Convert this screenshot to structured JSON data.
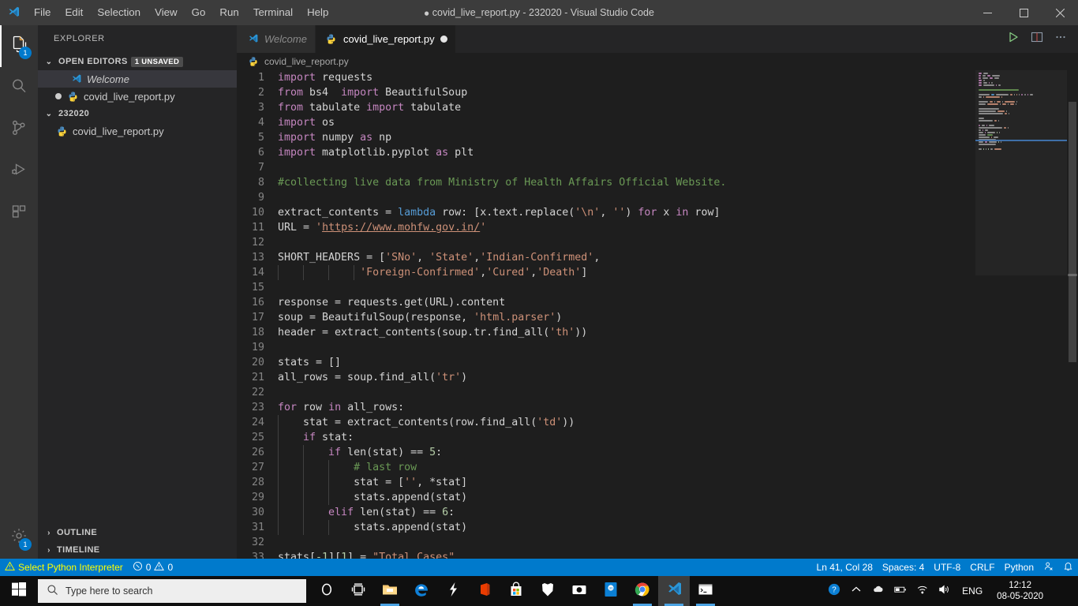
{
  "window": {
    "title": "covid_live_report.py - 232020 - Visual Studio Code",
    "dirty_marker": "●",
    "minimize_label": "Minimize",
    "maximize_label": "Maximize",
    "close_label": "Close"
  },
  "menubar": {
    "items": [
      {
        "label": "File"
      },
      {
        "label": "Edit"
      },
      {
        "label": "Selection"
      },
      {
        "label": "View"
      },
      {
        "label": "Go"
      },
      {
        "label": "Run"
      },
      {
        "label": "Terminal"
      },
      {
        "label": "Help"
      }
    ]
  },
  "activitybar": {
    "items": [
      {
        "name": "explorer",
        "icon": "files-icon",
        "badge": "1",
        "active": true
      },
      {
        "name": "search",
        "icon": "search-icon",
        "badge": "",
        "active": false
      },
      {
        "name": "source-control",
        "icon": "source-control-icon",
        "badge": "",
        "active": false
      },
      {
        "name": "run-and-debug",
        "icon": "run-debug-icon",
        "badge": "",
        "active": false
      },
      {
        "name": "extensions",
        "icon": "extensions-icon",
        "badge": "",
        "active": false
      }
    ],
    "bottom": [
      {
        "name": "manage",
        "icon": "gear-icon",
        "badge": "1"
      }
    ]
  },
  "sidebar": {
    "title": "EXPLORER",
    "open_editors": {
      "label": "OPEN EDITORS",
      "badge": "1 UNSAVED",
      "twisty": "⌄",
      "items": [
        {
          "label": "Welcome",
          "icon": "vscode-icon",
          "italic": true,
          "dirty": false,
          "selected": true
        },
        {
          "label": "covid_live_report.py",
          "icon": "python-icon",
          "italic": false,
          "dirty": true,
          "selected": false
        }
      ]
    },
    "folder": {
      "label": "232020",
      "twisty": "⌄",
      "items": [
        {
          "label": "covid_live_report.py",
          "icon": "python-icon"
        }
      ]
    },
    "bottom_sections": [
      {
        "label": "OUTLINE",
        "twisty": "›"
      },
      {
        "label": "TIMELINE",
        "twisty": "›"
      }
    ]
  },
  "editor": {
    "tabs": [
      {
        "label": "Welcome",
        "icon": "vscode-icon",
        "active": false,
        "dirty": false,
        "italic": true
      },
      {
        "label": "covid_live_report.py",
        "icon": "python-icon",
        "active": true,
        "dirty": true,
        "italic": false
      }
    ],
    "actions": [
      {
        "name": "run-python-file-button",
        "icon": "play-icon"
      },
      {
        "name": "split-editor-button",
        "icon": "split-editor-icon"
      },
      {
        "name": "more-actions-button",
        "icon": "ellipsis-icon"
      }
    ],
    "breadcrumb": {
      "icon": "python-icon",
      "label": "covid_live_report.py"
    },
    "code_lines": [
      {
        "n": 1,
        "tokens": [
          {
            "t": "import",
            "c": "kw"
          },
          {
            "t": " requests",
            "c": "ctext"
          }
        ]
      },
      {
        "n": 2,
        "tokens": [
          {
            "t": "from",
            "c": "kw"
          },
          {
            "t": " bs4  ",
            "c": "ctext"
          },
          {
            "t": "import",
            "c": "kw"
          },
          {
            "t": " BeautifulSoup",
            "c": "ctext"
          }
        ]
      },
      {
        "n": 3,
        "tokens": [
          {
            "t": "from",
            "c": "kw"
          },
          {
            "t": " tabulate ",
            "c": "ctext"
          },
          {
            "t": "import",
            "c": "kw"
          },
          {
            "t": " tabulate",
            "c": "ctext"
          }
        ]
      },
      {
        "n": 4,
        "tokens": [
          {
            "t": "import",
            "c": "kw"
          },
          {
            "t": " os",
            "c": "ctext"
          }
        ]
      },
      {
        "n": 5,
        "tokens": [
          {
            "t": "import",
            "c": "kw"
          },
          {
            "t": " numpy ",
            "c": "ctext"
          },
          {
            "t": "as",
            "c": "kw"
          },
          {
            "t": " np",
            "c": "ctext"
          }
        ]
      },
      {
        "n": 6,
        "tokens": [
          {
            "t": "import",
            "c": "kw"
          },
          {
            "t": " matplotlib.pyplot ",
            "c": "ctext"
          },
          {
            "t": "as",
            "c": "kw"
          },
          {
            "t": " plt",
            "c": "ctext"
          }
        ]
      },
      {
        "n": 7,
        "tokens": []
      },
      {
        "n": 8,
        "tokens": [
          {
            "t": "#collecting live data from Ministry of Health Affairs Official Website.",
            "c": "cmt"
          }
        ]
      },
      {
        "n": 9,
        "tokens": []
      },
      {
        "n": 10,
        "tokens": [
          {
            "t": "extract_contents = ",
            "c": "ctext"
          },
          {
            "t": "lambda",
            "c": "kw2"
          },
          {
            "t": " row: [x.text.replace(",
            "c": "ctext"
          },
          {
            "t": "'\\n'",
            "c": "str"
          },
          {
            "t": ", ",
            "c": "ctext"
          },
          {
            "t": "''",
            "c": "str"
          },
          {
            "t": ") ",
            "c": "ctext"
          },
          {
            "t": "for",
            "c": "kw"
          },
          {
            "t": " x ",
            "c": "ctext"
          },
          {
            "t": "in",
            "c": "kw"
          },
          {
            "t": " row]",
            "c": "ctext"
          }
        ]
      },
      {
        "n": 11,
        "tokens": [
          {
            "t": "URL = ",
            "c": "ctext"
          },
          {
            "t": "'",
            "c": "str"
          },
          {
            "t": "https://www.mohfw.gov.in/",
            "c": "link"
          },
          {
            "t": "'",
            "c": "str"
          }
        ]
      },
      {
        "n": 12,
        "tokens": []
      },
      {
        "n": 13,
        "tokens": [
          {
            "t": "SHORT_HEADERS = [",
            "c": "ctext"
          },
          {
            "t": "'SNo'",
            "c": "str"
          },
          {
            "t": ", ",
            "c": "ctext"
          },
          {
            "t": "'State'",
            "c": "str"
          },
          {
            "t": ",",
            "c": "ctext"
          },
          {
            "t": "'Indian-Confirmed'",
            "c": "str"
          },
          {
            "t": ",",
            "c": "ctext"
          }
        ]
      },
      {
        "n": 14,
        "tokens": [
          {
            "t": "             ",
            "c": "ctext"
          },
          {
            "t": "'Foreign-Confirmed'",
            "c": "str"
          },
          {
            "t": ",",
            "c": "ctext"
          },
          {
            "t": "'Cured'",
            "c": "str"
          },
          {
            "t": ",",
            "c": "ctext"
          },
          {
            "t": "'Death'",
            "c": "str"
          },
          {
            "t": "]",
            "c": "ctext"
          }
        ]
      },
      {
        "n": 15,
        "tokens": []
      },
      {
        "n": 16,
        "tokens": [
          {
            "t": "response = requests.get(URL).content",
            "c": "ctext"
          }
        ]
      },
      {
        "n": 17,
        "tokens": [
          {
            "t": "soup = BeautifulSoup(response, ",
            "c": "ctext"
          },
          {
            "t": "'html.parser'",
            "c": "str"
          },
          {
            "t": ")",
            "c": "ctext"
          }
        ]
      },
      {
        "n": 18,
        "tokens": [
          {
            "t": "header = extract_contents(soup.tr.find_all(",
            "c": "ctext"
          },
          {
            "t": "'th'",
            "c": "str"
          },
          {
            "t": "))",
            "c": "ctext"
          }
        ]
      },
      {
        "n": 19,
        "tokens": []
      },
      {
        "n": 20,
        "tokens": [
          {
            "t": "stats = []",
            "c": "ctext"
          }
        ]
      },
      {
        "n": 21,
        "tokens": [
          {
            "t": "all_rows = soup.find_all(",
            "c": "ctext"
          },
          {
            "t": "'tr'",
            "c": "str"
          },
          {
            "t": ")",
            "c": "ctext"
          }
        ]
      },
      {
        "n": 22,
        "tokens": []
      },
      {
        "n": 23,
        "tokens": [
          {
            "t": "for",
            "c": "kw"
          },
          {
            "t": " row ",
            "c": "ctext"
          },
          {
            "t": "in",
            "c": "kw"
          },
          {
            "t": " all_rows:",
            "c": "ctext"
          }
        ]
      },
      {
        "n": 24,
        "tokens": [
          {
            "t": "    stat = extract_contents(row.find_all(",
            "c": "ctext"
          },
          {
            "t": "'td'",
            "c": "str"
          },
          {
            "t": "))",
            "c": "ctext"
          }
        ]
      },
      {
        "n": 25,
        "tokens": [
          {
            "t": "    ",
            "c": "ctext"
          },
          {
            "t": "if",
            "c": "kw"
          },
          {
            "t": " stat:",
            "c": "ctext"
          }
        ]
      },
      {
        "n": 26,
        "tokens": [
          {
            "t": "        ",
            "c": "ctext"
          },
          {
            "t": "if",
            "c": "kw"
          },
          {
            "t": " len(stat) == ",
            "c": "ctext"
          },
          {
            "t": "5",
            "c": "num"
          },
          {
            "t": ":",
            "c": "ctext"
          }
        ]
      },
      {
        "n": 27,
        "tokens": [
          {
            "t": "            ",
            "c": "ctext"
          },
          {
            "t": "# last row",
            "c": "cmt"
          }
        ]
      },
      {
        "n": 28,
        "tokens": [
          {
            "t": "            stat = [",
            "c": "ctext"
          },
          {
            "t": "''",
            "c": "str"
          },
          {
            "t": ", *stat]",
            "c": "ctext"
          }
        ]
      },
      {
        "n": 29,
        "tokens": [
          {
            "t": "            stats.append(stat)",
            "c": "ctext"
          }
        ]
      },
      {
        "n": 30,
        "tokens": [
          {
            "t": "        ",
            "c": "ctext"
          },
          {
            "t": "elif",
            "c": "kw"
          },
          {
            "t": " len(stat) == ",
            "c": "ctext"
          },
          {
            "t": "6",
            "c": "num"
          },
          {
            "t": ":",
            "c": "ctext"
          }
        ]
      },
      {
        "n": 31,
        "tokens": [
          {
            "t": "            stats.append(stat)",
            "c": "ctext"
          }
        ]
      },
      {
        "n": 32,
        "tokens": []
      },
      {
        "n": 33,
        "tokens": [
          {
            "t": "stats[",
            "c": "ctext"
          },
          {
            "t": "-1",
            "c": "num"
          },
          {
            "t": "][",
            "c": "ctext"
          },
          {
            "t": "1",
            "c": "num"
          },
          {
            "t": "] = ",
            "c": "ctext"
          },
          {
            "t": "\"Total Cases\"",
            "c": "str"
          }
        ]
      }
    ]
  },
  "statusbar": {
    "left": [
      {
        "name": "python-interpreter",
        "icon": "warning-icon",
        "label": "Select Python Interpreter",
        "warn": true
      },
      {
        "name": "problems",
        "icon": "error-warning-icons",
        "label": "0 0",
        "errors": "0",
        "warnings": "0",
        "warn": false
      }
    ],
    "right": [
      {
        "name": "editor-position",
        "label": "Ln 41, Col 28"
      },
      {
        "name": "editor-indentation",
        "label": "Spaces: 4"
      },
      {
        "name": "editor-encoding",
        "label": "UTF-8"
      },
      {
        "name": "editor-eol",
        "label": "CRLF"
      },
      {
        "name": "editor-language",
        "label": "Python"
      },
      {
        "name": "live-share",
        "label": "",
        "icon": "live-share-icon"
      },
      {
        "name": "notifications",
        "label": "",
        "icon": "bell-icon"
      }
    ]
  },
  "taskbar": {
    "start_label": "Start",
    "search": {
      "placeholder": "Type here to search",
      "value": "",
      "icon": "search-icon"
    },
    "icons": [
      {
        "name": "cortana-icon",
        "running": false,
        "active": false
      },
      {
        "name": "task-view-icon",
        "running": false,
        "active": false
      },
      {
        "name": "file-explorer-icon",
        "running": true,
        "active": false
      },
      {
        "name": "microsoft-edge-icon",
        "running": false,
        "active": false
      },
      {
        "name": "flash-app-icon",
        "running": false,
        "active": false
      },
      {
        "name": "microsoft-office-icon",
        "running": false,
        "active": false
      },
      {
        "name": "microsoft-store-icon",
        "running": false,
        "active": false
      },
      {
        "name": "brave-browser-icon",
        "running": false,
        "active": false
      },
      {
        "name": "camera-icon",
        "running": false,
        "active": false
      },
      {
        "name": "zoom-icon",
        "running": false,
        "active": false
      },
      {
        "name": "google-chrome-icon",
        "running": true,
        "active": false
      },
      {
        "name": "visual-studio-code-icon",
        "running": true,
        "active": true
      },
      {
        "name": "command-prompt-icon",
        "running": true,
        "active": false
      }
    ],
    "tray": {
      "help_icon": "help-circle-icon",
      "chevron_icon": "chevron-up-icon",
      "onedrive_icon": "onedrive-icon",
      "battery_icon": "battery-icon",
      "wifi_icon": "wifi-icon",
      "volume_icon": "volume-icon",
      "language": "ENG",
      "time": "12:12",
      "date": "08-05-2020",
      "action_center_icon": "action-center-icon"
    }
  },
  "colors": {
    "accent": "#007acc",
    "titlebar": "#3c3c3c",
    "sidebar": "#252526",
    "activitybar": "#333333",
    "editor": "#1e1e1e",
    "taskbar": "#0f0f0f"
  }
}
